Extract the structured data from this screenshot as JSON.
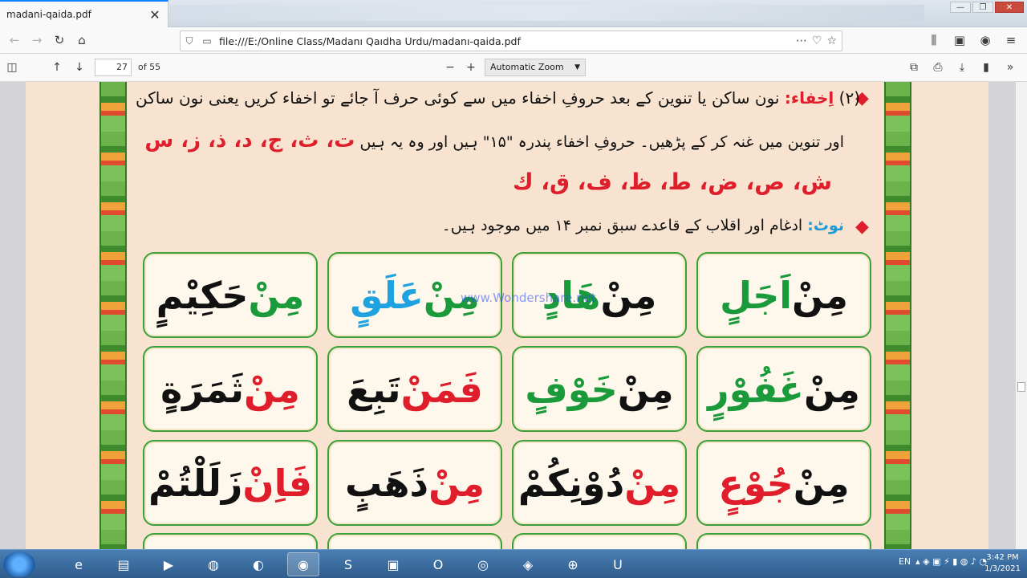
{
  "browser": {
    "tab_title": "madani-qaida.pdf",
    "tab_close": "✕",
    "window_minimize": "—",
    "window_restore": "❐",
    "window_close": "✕",
    "url": "file:///E:/Online Class/Madanı Qaıdha Urdu/madanı-qaida.pdf"
  },
  "pdf_toolbar": {
    "page_number": "27",
    "page_total": "of 55",
    "zoom": "Automatic Zoom"
  },
  "page": {
    "rule_number": "(۲)",
    "rule_title": "اِخفاء:",
    "rule_text_1": "نون ساکن یا تنوین کے بعد حروفِ اخفاء میں سے کوئی حرف آ جائے تو اخفاء کریں یعنی نون ساکن",
    "rule_text_2": "اور تنوین میں غنہ کر کے پڑھیں۔ حروفِ اخفاء پندرہ \"۱۵\" ہیں اور وہ یہ ہیں",
    "letters_a": "ت، ث، ج، د، ذ، ز، س",
    "letters_b": "ش، ص، ض، ط، ظ، ف، ق، ك",
    "note_label": "نوٹ:",
    "note_text": "ادغام اور اقلاب کے قاعدے سبق نمبر ۱۴ میں موجود ہیں۔",
    "watermark": "www.Wondershare.net",
    "cards": [
      {
        "a": "مِنْ ",
        "b": "اَجَلٍ",
        "ca": "k",
        "cb": "g"
      },
      {
        "a": "مِنْ ",
        "b": "هَادٍ",
        "ca": "k",
        "cb": "g"
      },
      {
        "a": "مِنْ ",
        "b": "عَلَقٍ",
        "ca": "g",
        "cb": "b"
      },
      {
        "a": "مِنْ ",
        "b": "حَكِيْمٍ",
        "ca": "g",
        "cb": "k"
      },
      {
        "a": "مِنْ ",
        "b": "غَفُوْرٍ",
        "ca": "k",
        "cb": "g"
      },
      {
        "a": "مِنْ ",
        "b": "خَوْفٍ",
        "ca": "k",
        "cb": "g"
      },
      {
        "a": "فَمَنْ ",
        "b": "تَبِعَ",
        "ca": "r",
        "cb": "k"
      },
      {
        "a": "مِنْ ",
        "b": "ثَمَرَةٍ",
        "ca": "r",
        "cb": "k"
      },
      {
        "a": "مِنْ ",
        "b": "جُوْعٍ",
        "ca": "k",
        "cb": "r"
      },
      {
        "a": "مِنْ ",
        "b": "دُوْنِكُمْ",
        "ca": "r",
        "cb": "k"
      },
      {
        "a": "مِنْ ",
        "b": "ذَهَبٍ",
        "ca": "r",
        "cb": "k"
      },
      {
        "a": "فَاِنْ ",
        "b": "زَلَلْتُمْ",
        "ca": "r",
        "cb": "k"
      }
    ]
  },
  "taskbar": {
    "language": "EN",
    "time": "3:42 PM",
    "date": "1/3/2021"
  }
}
